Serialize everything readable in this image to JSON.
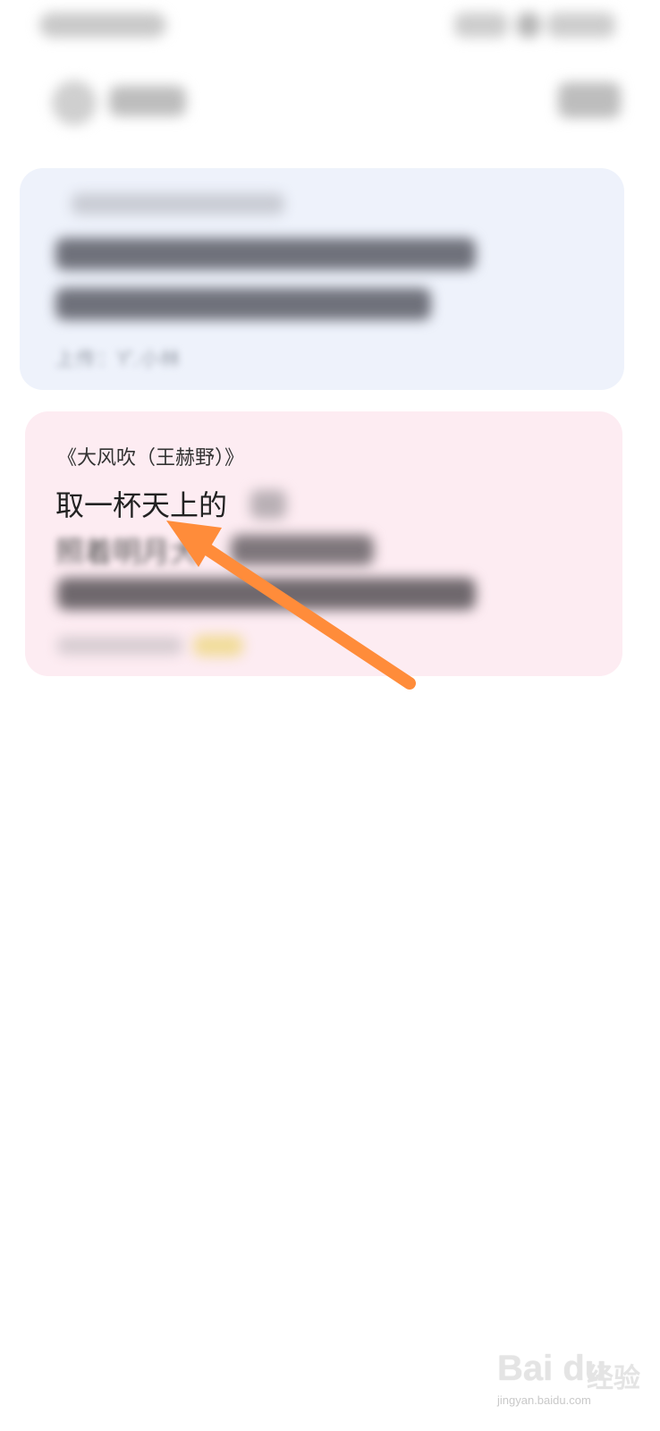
{
  "card_uploaded": {
    "uploader": "上传：Ƴ.小林"
  },
  "card_lyric": {
    "source": "《大风吹（王赫野）》",
    "line1_visible": "取一杯天上的",
    "line2_visible": "照着明月大"
  },
  "watermark": {
    "logo": "Bai du",
    "name": "经验",
    "url": "jingyan.baidu.com"
  },
  "annotation": {
    "arrow_color": "#ff8c3a"
  }
}
